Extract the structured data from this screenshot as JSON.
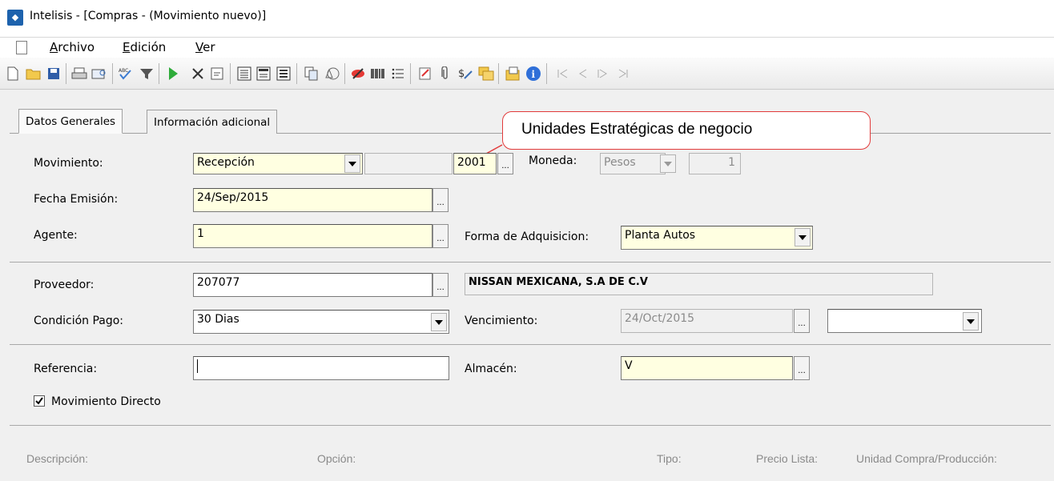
{
  "window": {
    "title": "Intelisis - [Compras - (Movimiento nuevo)]"
  },
  "menu": {
    "items": [
      "Archivo",
      "Edición",
      "Ver"
    ]
  },
  "toolbar": {
    "icons": [
      "new-document-icon",
      "open-folder-icon",
      "save-icon",
      "print-icon",
      "print-preview-icon",
      "spell-check-icon",
      "filter-icon",
      "play-icon",
      "close-icon",
      "scroll-icon",
      "view-details-icon",
      "view-form-icon",
      "view-list-icon",
      "copy-icon",
      "shapes-icon",
      "no-entry-icon",
      "barcode-icon",
      "list-icon",
      "edit-report-icon",
      "attachment-icon",
      "money-icon",
      "folders-icon",
      "import-icon",
      "info-icon",
      "first-icon",
      "previous-icon",
      "next-icon",
      "last-icon"
    ]
  },
  "tabs": [
    "Datos Generales",
    "Información adicional"
  ],
  "annotation": {
    "text": "Unidades Estratégicas de negocio",
    "color": "#e23b3b"
  },
  "form": {
    "movimiento": {
      "label": "Movimiento:",
      "value": "Recepción",
      "uen": "2001"
    },
    "moneda": {
      "label": "Moneda:",
      "value": "Pesos",
      "tipo_cambio": "1"
    },
    "fecha_emision": {
      "label": "Fecha Emisión:",
      "value": "24/Sep/2015"
    },
    "agente": {
      "label": "Agente:",
      "value": "1"
    },
    "forma_adquisicion": {
      "label": "Forma de Adquisicion:",
      "value": "Planta Autos"
    },
    "proveedor": {
      "label": "Proveedor:",
      "value": "207077",
      "nombre": "NISSAN MEXICANA, S.A DE C.V"
    },
    "condicion_pago": {
      "label": "Condición Pago:",
      "value": "30 Dias"
    },
    "vencimiento": {
      "label": "Vencimiento:",
      "value": "24/Oct/2015",
      "extra": ""
    },
    "referencia": {
      "label": "Referencia:",
      "value": ""
    },
    "almacen": {
      "label": "Almacén:",
      "value": "V"
    },
    "movimiento_directo": {
      "label": "Movimiento Directo",
      "checked": true
    }
  },
  "columns": [
    "Descripción:",
    "Opción:",
    "Tipo:",
    "Precio Lista:",
    "Unidad Compra/Producción:"
  ]
}
